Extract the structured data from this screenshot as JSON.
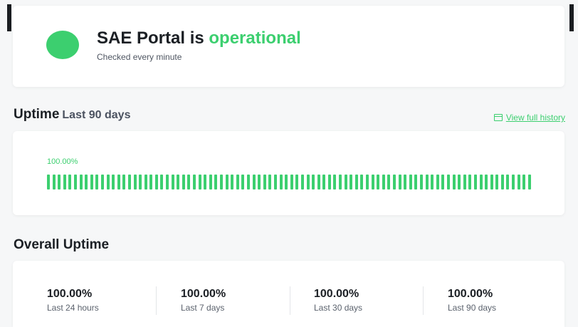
{
  "status": {
    "title_prefix": "SAE Portal is",
    "state": "operational",
    "subtitle": "Checked every minute",
    "state_color": "#3ccf6f"
  },
  "uptime": {
    "heading": "Uptime",
    "range": "Last 90 days",
    "history_link": "View full history",
    "history_icon": "calendar-icon",
    "percent": "100.00%",
    "day_count": 90,
    "day_status": "up"
  },
  "overall": {
    "heading": "Overall Uptime",
    "stats": [
      {
        "value": "100.00%",
        "label": "Last 24 hours"
      },
      {
        "value": "100.00%",
        "label": "Last 7 days"
      },
      {
        "value": "100.00%",
        "label": "Last 30 days"
      },
      {
        "value": "100.00%",
        "label": "Last 90 days"
      }
    ]
  }
}
